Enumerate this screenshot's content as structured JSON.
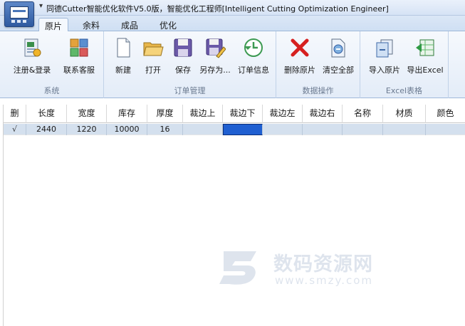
{
  "window": {
    "title": "同德Cutter智能优化软件V5.0版，智能优化工程师[Intelligent Cutting Optimization Engineer]",
    "quick_access_glyph": "▾"
  },
  "tabs": [
    {
      "label": "原片",
      "active": true
    },
    {
      "label": "余料",
      "active": false
    },
    {
      "label": "成品",
      "active": false
    },
    {
      "label": "优化",
      "active": false
    }
  ],
  "ribbon": {
    "groups": [
      {
        "label": "系统",
        "buttons": [
          {
            "label": "注册&登录",
            "icon": "register-login-icon"
          },
          {
            "label": "联系客服",
            "icon": "contact-support-icon"
          }
        ]
      },
      {
        "label": "订单管理",
        "buttons": [
          {
            "label": "新建",
            "icon": "new-document-icon"
          },
          {
            "label": "打开",
            "icon": "open-folder-icon"
          },
          {
            "label": "保存",
            "icon": "save-disk-icon"
          },
          {
            "label": "另存为...",
            "icon": "save-as-icon"
          },
          {
            "label": "订单信息",
            "icon": "order-info-icon"
          }
        ]
      },
      {
        "label": "数据操作",
        "buttons": [
          {
            "label": "删除原片",
            "icon": "delete-x-icon"
          },
          {
            "label": "清空全部",
            "icon": "clear-all-icon"
          }
        ]
      },
      {
        "label": "Excel表格",
        "buttons": [
          {
            "label": "导入原片",
            "icon": "import-icon"
          },
          {
            "label": "导出Excel",
            "icon": "export-excel-icon"
          }
        ]
      }
    ]
  },
  "table": {
    "columns": [
      "删",
      "长度",
      "宽度",
      "库存",
      "厚度",
      "裁边上",
      "裁边下",
      "裁边左",
      "裁边右",
      "名称",
      "材质",
      "颜色"
    ],
    "rows": [
      {
        "delete_mark": "√",
        "length": "2440",
        "width": "1220",
        "stock": "10000",
        "thickness": "16",
        "trim_top": "",
        "trim_bottom": "",
        "trim_left": "",
        "trim_right": "",
        "name": "",
        "material": "",
        "color": ""
      }
    ]
  },
  "watermark": {
    "text": "数码资源网",
    "url": "www.smzy.com"
  },
  "colors": {
    "accent": "#1f5fd1",
    "selected_row": "#d4e0ee",
    "ribbon_bg": "#e3ecf8"
  }
}
